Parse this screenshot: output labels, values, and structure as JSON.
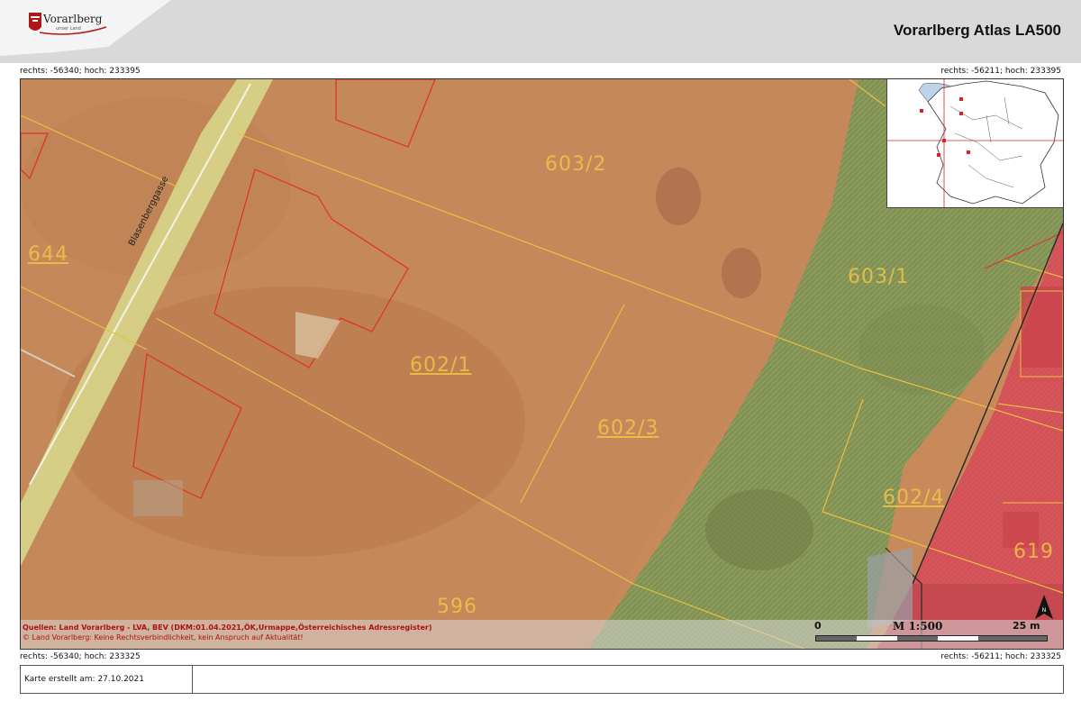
{
  "header": {
    "logo_text": "Vorarlberg",
    "logo_subtext": "unser Land",
    "title": "Vorarlberg Atlas LA500"
  },
  "coordinates": {
    "top_left": "rechts: -56340; hoch: 233395",
    "top_right": "rechts: -56211; hoch: 233395",
    "bottom_left": "rechts: -56340; hoch: 233325",
    "bottom_right": "rechts: -56211; hoch: 233325"
  },
  "map": {
    "street_name": "Blasenberggasse",
    "parcels": [
      {
        "id": "603-2",
        "label": "603/2",
        "underlined": false
      },
      {
        "id": "644",
        "label": "644",
        "underlined": true
      },
      {
        "id": "603-1",
        "label": "603/1",
        "underlined": false
      },
      {
        "id": "602-1",
        "label": "602/1",
        "underlined": true
      },
      {
        "id": "602-3",
        "label": "602/3",
        "underlined": true
      },
      {
        "id": "602-4",
        "label": "602/4",
        "underlined": true
      },
      {
        "id": "619",
        "label": "619",
        "underlined": false
      },
      {
        "id": "596",
        "label": "596",
        "underlined": false
      }
    ],
    "zone_colors": {
      "orange": "#c88a5a",
      "green": "#8a9a5a",
      "red": "#d9535a",
      "street": "#d7d68a",
      "parcel_line": "#e8c040",
      "building_line": "#e03020"
    },
    "credits_line1": "Quellen: Land Vorarlberg - LVA, BEV (DKM:01.04.2021,ÖK,Urmappe,Österreichisches Adressregister)",
    "credits_line2": "© Land Vorarlberg: Keine Rechtsverbindlichkeit, kein Anspruch auf Aktualität!",
    "scale": {
      "start": "0",
      "label": "M 1:500",
      "end": "25 m"
    },
    "north_letter": "N"
  },
  "footer": {
    "created": "Karte erstellt am: 27.10.2021"
  }
}
